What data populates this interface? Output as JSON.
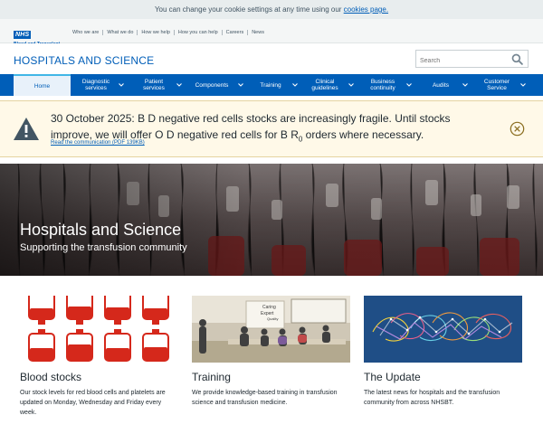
{
  "cookie": {
    "text": "You can change your cookie settings at any time using our ",
    "link": "cookies page."
  },
  "logo": {
    "badge": "NHS",
    "text": "Blood and Transplant"
  },
  "util_links": [
    "Who we are",
    "What we do",
    "How we help",
    "How you can help",
    "Careers",
    "News"
  ],
  "site_title": "HOSPITALS AND SCIENCE",
  "search": {
    "placeholder": "Search"
  },
  "nav": [
    {
      "label": "Home",
      "line2": ""
    },
    {
      "label": "Diagnostic",
      "line2": "services"
    },
    {
      "label": "Patient",
      "line2": "services"
    },
    {
      "label": "Components",
      "line2": ""
    },
    {
      "label": "Training",
      "line2": ""
    },
    {
      "label": "Clinical",
      "line2": "guidelines"
    },
    {
      "label": "Business",
      "line2": "continuity"
    },
    {
      "label": "Audits",
      "line2": ""
    },
    {
      "label": "Customer",
      "line2": "Service"
    }
  ],
  "alert": {
    "line_a": "30 October 2025: B D negative red cells stocks are increasingly fragile. Until stocks improve, we will offer O D negative red cells for B R",
    "sub": "0",
    "line_b": " orders where necessary.",
    "link": "Read the communication (PDF 139KB)"
  },
  "hero": {
    "title": "Hospitals and Science",
    "subtitle": "Supporting the transfusion community"
  },
  "cards": [
    {
      "title": "Blood stocks",
      "desc": "Our stock levels for red blood cells and platelets are updated on Monday, Wednesday and Friday every week."
    },
    {
      "title": "Training",
      "desc": "We provide knowledge-based training in transfusion science and transfusion medicine.",
      "board": [
        "Caring",
        "Expert",
        "Quality"
      ]
    },
    {
      "title": "The Update",
      "desc": "The latest news for hospitals and the transfusion community from across NHSBT."
    }
  ],
  "colors": {
    "nhs_blue": "#005eb8",
    "alert_bg": "#fff9e8",
    "blood_red": "#d5281b"
  },
  "icons": [
    "search-icon",
    "chevron-down-icon",
    "warning-icon",
    "close-icon"
  ]
}
